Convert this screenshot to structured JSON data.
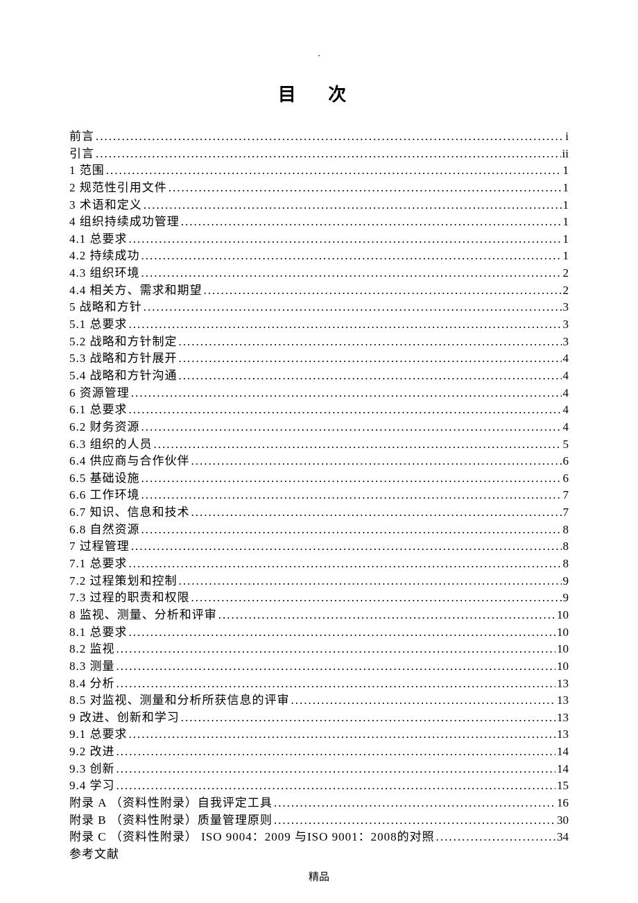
{
  "header_dot": ".",
  "title": "目 次",
  "toc": [
    {
      "label": "前言",
      "page": "i"
    },
    {
      "label": "引言",
      "page": "ii"
    },
    {
      "label": "1   范围",
      "page": "1"
    },
    {
      "label": "2   规范性引用文件 ",
      "page": "1"
    },
    {
      "label": "3   术语和定义",
      "page": "1"
    },
    {
      "label": "4   组织持续成功管理",
      "page": "1"
    },
    {
      "label": "4.1 总要求",
      "page": "1"
    },
    {
      "label": "4.2 持续成功",
      "page": "1"
    },
    {
      "label": "4.3 组织环境",
      "page": "2"
    },
    {
      "label": "4.4 相关方、需求和期望",
      "page": "2"
    },
    {
      "label": "5   战略和方针",
      "page": "3"
    },
    {
      "label": "5.1 总要求",
      "page": "3"
    },
    {
      "label": "5.2 战略和方针制定",
      "page": "3"
    },
    {
      "label": "5.3 战略和方针展开",
      "page": "4"
    },
    {
      "label": "5.4 战略和方针沟通 ",
      "page": "4"
    },
    {
      "label": "6   资源管理",
      "page": "4"
    },
    {
      "label": "6.1 总要求",
      "page": "4"
    },
    {
      "label": "6.2 财务资源",
      "page": "4"
    },
    {
      "label": "6.3 组织的人员",
      "page": "5"
    },
    {
      "label": "6.4 供应商与合作伙伴",
      "page": "6"
    },
    {
      "label": "6.5 基础设施",
      "page": "6"
    },
    {
      "label": "6.6 工作环境",
      "page": "7"
    },
    {
      "label": "6.7 知识、信息和技术",
      "page": "7"
    },
    {
      "label": "6.8 自然资源 ",
      "page": "8"
    },
    {
      "label": "7   过程管理",
      "page": "8"
    },
    {
      "label": "7.1 总要求",
      "page": "8"
    },
    {
      "label": "7.2 过程策划和控制",
      "page": "9"
    },
    {
      "label": "7.3 过程的职责和权限",
      "page": "9"
    },
    {
      "label": "8   监视、测量、分析和评审",
      "page": "10"
    },
    {
      "label": "8.1 总要求",
      "page": "10"
    },
    {
      "label": "8.2 监视",
      "page": "10"
    },
    {
      "label": "8.3 测量",
      "page": "10"
    },
    {
      "label": "8.4 分析",
      "page": "13"
    },
    {
      "label": "8.5 对监视、测量和分析所获信息的评审",
      "page": "13"
    },
    {
      "label": "9   改进、创新和学习",
      "page": "13"
    },
    {
      "label": "9.1 总要求",
      "page": "13"
    },
    {
      "label": "9.2 改进",
      "page": "14"
    },
    {
      "label": "9.3 创新",
      "page": "14"
    },
    {
      "label": "9.4 学习",
      "page": "15"
    },
    {
      "label": "附录 A （资料性附录）自我评定工具 ",
      "page": "16"
    },
    {
      "label": "附录 B （资料性附录）质量管理原则 ",
      "page": "30"
    },
    {
      "label": "附录 C （资料性附录） ISO 9004：2009 与ISO 9001：2008的对照",
      "page": "34"
    },
    {
      "label": "参考文献",
      "page": ""
    }
  ],
  "dots_fill": "........................................................................................................................",
  "footer": "精品"
}
